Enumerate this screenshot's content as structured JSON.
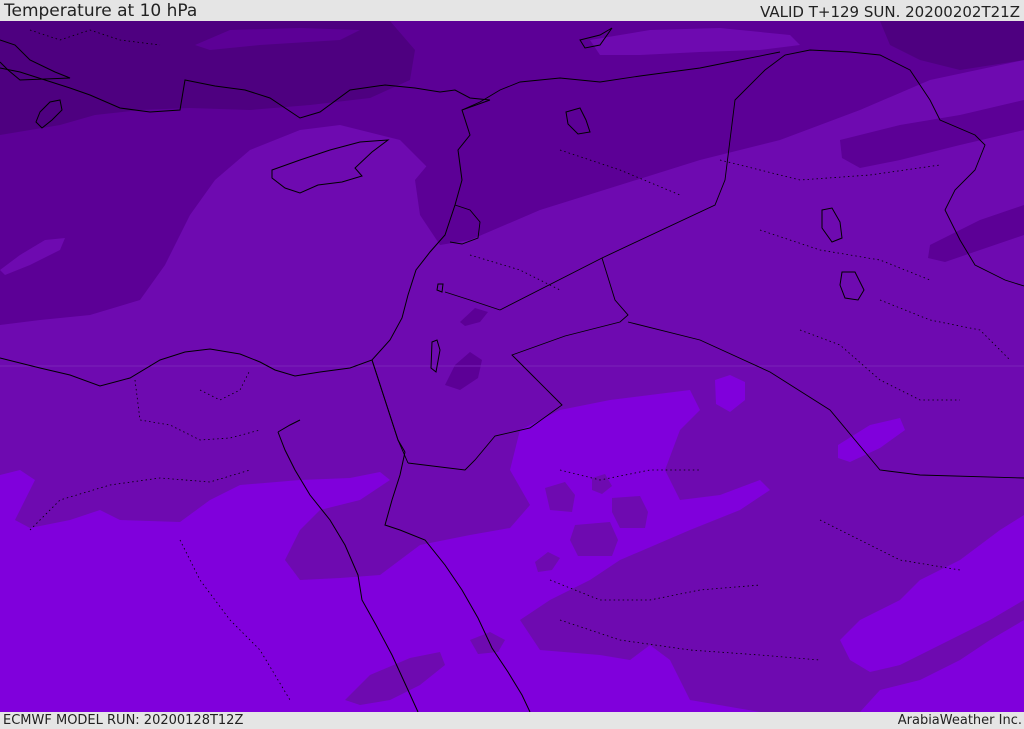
{
  "header": {
    "title": "Temperature at 10 hPa",
    "valid": "VALID T+129 SUN. 20200202T21Z"
  },
  "footer": {
    "model_run": "ECMWF MODEL RUN: 20200128T12Z",
    "credit": "ArabiaWeather Inc."
  },
  "colors": {
    "darkest": "#4e0080",
    "dark": "#5c0096",
    "mid": "#6e0ab0",
    "light": "#8000dc",
    "frame": "#e5e5e5",
    "lines": "#000000"
  }
}
